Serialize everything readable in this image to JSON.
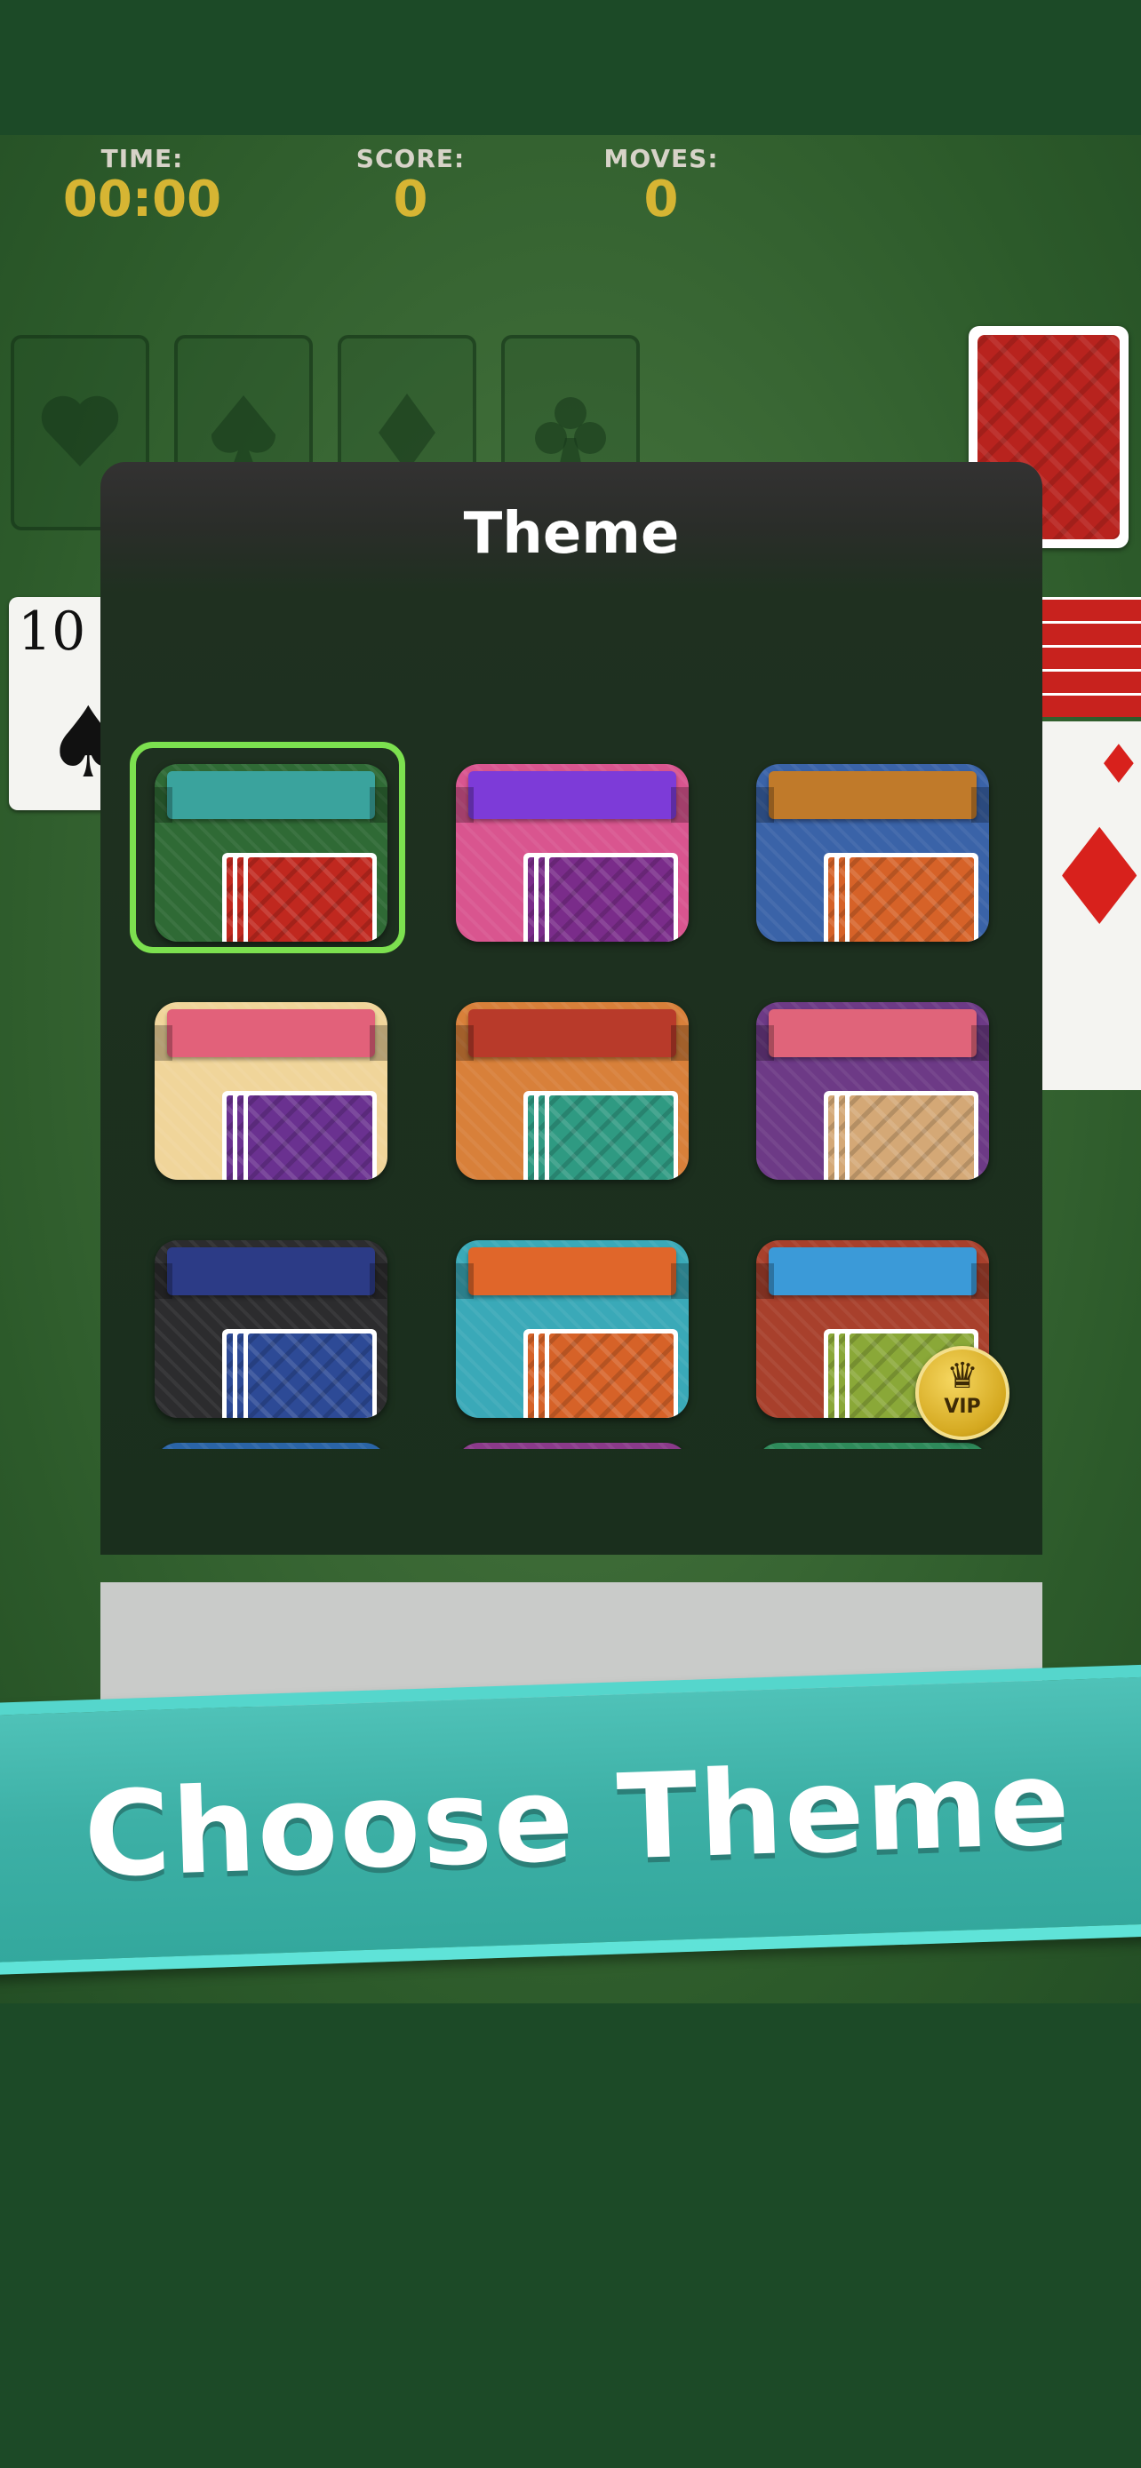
{
  "hud": {
    "time_label": "TIME:",
    "time_value": "00:00",
    "score_label": "SCORE:",
    "score_value": "0",
    "moves_label": "MOVES:",
    "moves_value": "0"
  },
  "tableau": {
    "visible_card_rank": "10",
    "visible_card_suit": "♠",
    "right_card_suit": "♦"
  },
  "modal": {
    "title": "Theme"
  },
  "vip_badge": {
    "text": "VIP",
    "icon": "crown-icon"
  },
  "promo": {
    "headline": "Choose Theme"
  },
  "themes": [
    {
      "bg": "#2f6a35",
      "banner": "#3aa39d",
      "card": "#c0281f",
      "selected": true
    },
    {
      "bg": "#d9558f",
      "banner": "#7d3bd8",
      "card": "#7a2c8a"
    },
    {
      "bg": "#3a63a8",
      "banner": "#c07a2a",
      "card": "#d66228"
    },
    {
      "bg": "#f0d59a",
      "banner": "#e2617a",
      "card": "#6a3190"
    },
    {
      "bg": "#d8803a",
      "banner": "#b83a2a",
      "card": "#2f9a82"
    },
    {
      "bg": "#6d3a86",
      "banner": "#e0647a",
      "card": "#d4a876"
    },
    {
      "bg": "#2c2c2e",
      "banner": "#2c3b86",
      "card": "#2d4a96"
    },
    {
      "bg": "#3aa9b8",
      "banner": "#e0662a",
      "card": "#d66228"
    },
    {
      "bg": "#a8402c",
      "banner": "#3b9ad8",
      "card": "#8aa838",
      "vip": true
    },
    {
      "bg": "#2a64a6",
      "banner": "#a8241f",
      "card": "#2a64a6"
    },
    {
      "bg": "#8a3a8a",
      "banner": "#5aa83a",
      "card": "#8a3a8a"
    },
    {
      "bg": "#2e8a5a",
      "banner": "#d6802a",
      "card": "#2e8a5a"
    }
  ]
}
